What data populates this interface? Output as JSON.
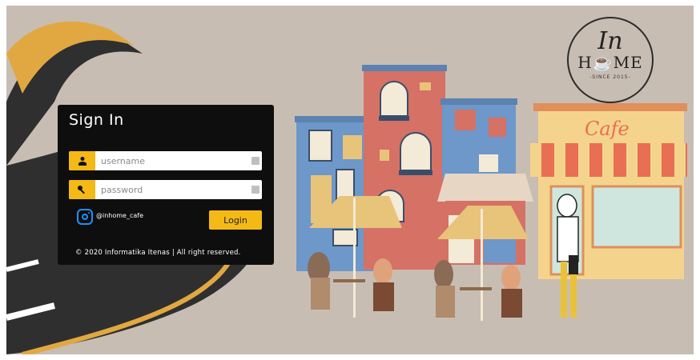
{
  "logo": {
    "line1": "In",
    "line2": "H☕ME",
    "since": "-SINCE 2015-"
  },
  "cafe_sign": "Cafe",
  "login": {
    "title": "Sign In",
    "username_placeholder": "username",
    "password_placeholder": "password",
    "instagram_handle": "@inhome_cafe",
    "button_label": "Login",
    "copyright": "© 2020 Informatika Itenas | All right reserved."
  },
  "colors": {
    "accent": "#f5b915",
    "panel": "#0e0e0e",
    "background": "#c8bdb3",
    "instagram": "#1e90ff"
  },
  "icons": {
    "username": "user-icon",
    "password": "key-icon",
    "social": "instagram-icon"
  }
}
